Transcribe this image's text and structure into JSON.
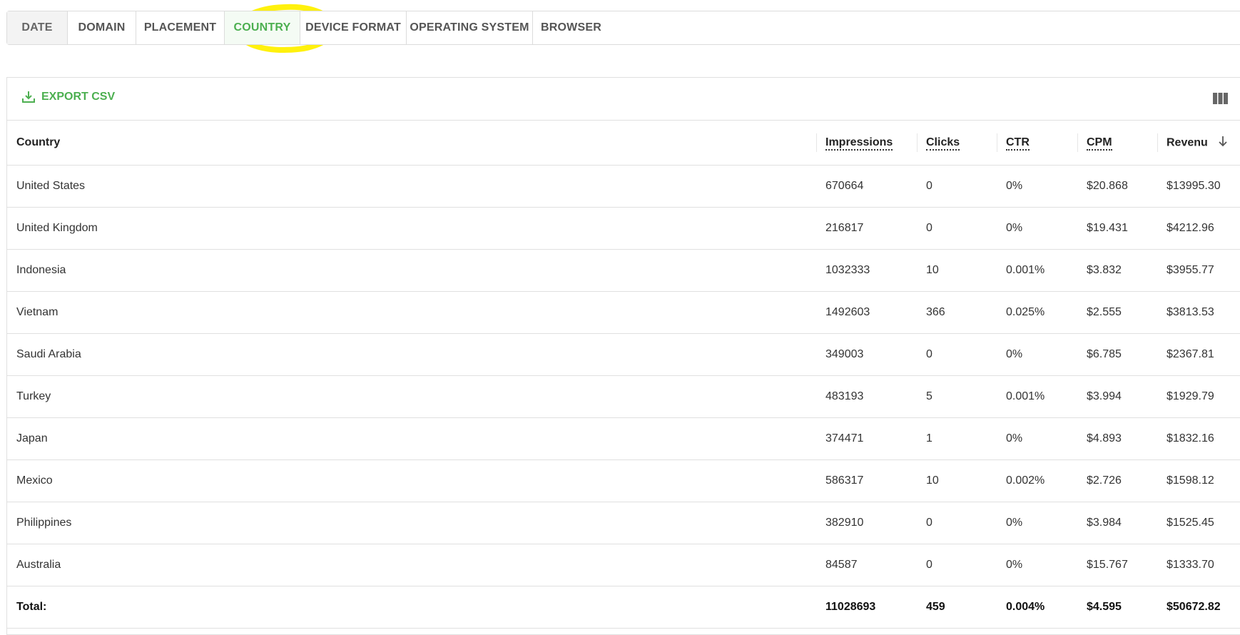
{
  "tabs": [
    {
      "label": "DATE"
    },
    {
      "label": "DOMAIN"
    },
    {
      "label": "PLACEMENT"
    },
    {
      "label": "COUNTRY"
    },
    {
      "label": "DEVICE FORMAT"
    },
    {
      "label": "OPERATING SYSTEM"
    },
    {
      "label": "BROWSER"
    }
  ],
  "active_tab": "COUNTRY",
  "toolbar": {
    "export_label": "EXPORT CSV",
    "export_icon": "download-icon",
    "columns_icon": "columns-icon"
  },
  "table": {
    "headers": [
      "Country",
      "Impressions",
      "Clicks",
      "CTR",
      "CPM",
      "Revenu"
    ],
    "sorted_column": "Revenu",
    "sort_direction": "desc",
    "rows": [
      [
        "United States",
        "670664",
        "0",
        "0%",
        "$20.868",
        "$13995.30"
      ],
      [
        "United Kingdom",
        "216817",
        "0",
        "0%",
        "$19.431",
        "$4212.96"
      ],
      [
        "Indonesia",
        "1032333",
        "10",
        "0.001%",
        "$3.832",
        "$3955.77"
      ],
      [
        "Vietnam",
        "1492603",
        "366",
        "0.025%",
        "$2.555",
        "$3813.53"
      ],
      [
        "Saudi Arabia",
        "349003",
        "0",
        "0%",
        "$6.785",
        "$2367.81"
      ],
      [
        "Turkey",
        "483193",
        "5",
        "0.001%",
        "$3.994",
        "$1929.79"
      ],
      [
        "Japan",
        "374471",
        "1",
        "0%",
        "$4.893",
        "$1832.16"
      ],
      [
        "Mexico",
        "586317",
        "10",
        "0.002%",
        "$2.726",
        "$1598.12"
      ],
      [
        "Philippines",
        "382910",
        "0",
        "0%",
        "$3.984",
        "$1525.45"
      ],
      [
        "Australia",
        "84587",
        "0",
        "0%",
        "$15.767",
        "$1333.70"
      ]
    ],
    "total": [
      "Total:",
      "11028693",
      "459",
      "0.004%",
      "$4.595",
      "$50672.82"
    ]
  },
  "colors": {
    "accent": "#4caf50",
    "highlight": "#ffee00"
  }
}
